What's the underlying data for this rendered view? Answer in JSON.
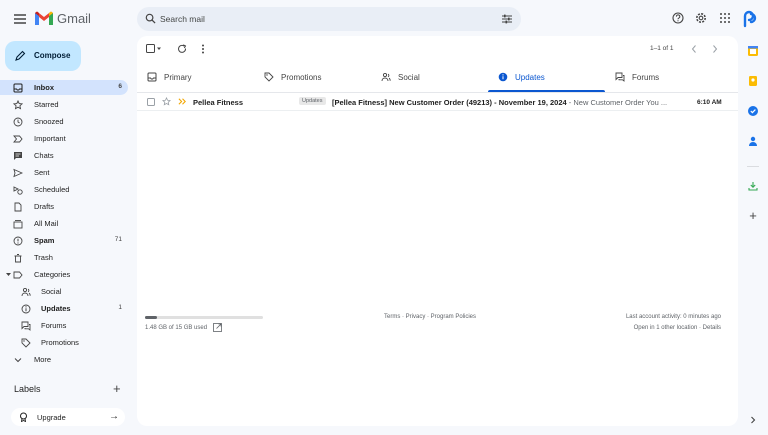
{
  "header": {
    "app_name": "Gmail",
    "search_placeholder": "Search mail"
  },
  "nav": {
    "compose_label": "Compose",
    "items": [
      {
        "label": "Inbox",
        "count": "6",
        "icon": "inbox-icon"
      },
      {
        "label": "Starred",
        "count": "",
        "icon": "star-icon"
      },
      {
        "label": "Snoozed",
        "count": "",
        "icon": "clock-icon"
      },
      {
        "label": "Important",
        "count": "",
        "icon": "important-icon"
      },
      {
        "label": "Chats",
        "count": "",
        "icon": "chat-icon"
      },
      {
        "label": "Sent",
        "count": "",
        "icon": "send-icon"
      },
      {
        "label": "Scheduled",
        "count": "",
        "icon": "scheduled-icon"
      },
      {
        "label": "Drafts",
        "count": "",
        "icon": "draft-icon"
      },
      {
        "label": "All Mail",
        "count": "",
        "icon": "all-mail-icon"
      },
      {
        "label": "Spam",
        "count": "71",
        "icon": "spam-icon"
      },
      {
        "label": "Trash",
        "count": "",
        "icon": "trash-icon"
      },
      {
        "label": "Categories",
        "count": "",
        "icon": "label-icon"
      },
      {
        "label": "Social",
        "count": "",
        "icon": "social-icon"
      },
      {
        "label": "Updates",
        "count": "1",
        "icon": "info-icon"
      },
      {
        "label": "Forums",
        "count": "",
        "icon": "forum-icon"
      },
      {
        "label": "Promotions",
        "count": "",
        "icon": "tag-icon"
      },
      {
        "label": "More",
        "count": "",
        "icon": "chevron-down-icon"
      }
    ],
    "labels_heading": "Labels",
    "upgrade_label": "Upgrade"
  },
  "toolbar": {
    "pager_text": "1–1 of 1"
  },
  "tabs": [
    {
      "label": "Primary",
      "active": false
    },
    {
      "label": "Promotions",
      "active": false
    },
    {
      "label": "Social",
      "active": false
    },
    {
      "label": "Updates",
      "active": true
    },
    {
      "label": "Forums",
      "active": false
    }
  ],
  "emails": [
    {
      "sender": "Pellea Fitness",
      "badge": "Updates",
      "subject": "[Pellea Fitness] New Customer Order (49213) - November 19, 2024",
      "snippet": " - New Customer Order You ...",
      "time": "6:10 AM"
    }
  ],
  "footer": {
    "storage_text": "1.48 GB of 15 GB used",
    "storage_fraction": 0.099,
    "links": "Terms · Privacy · Program Policies",
    "activity": "Last account activity: 0 minutes ago",
    "other_location": "Open in 1 other location · Details"
  },
  "colors": {
    "accent": "#0b57d0",
    "compose_bg": "#c2e7ff",
    "active_nav_bg": "#d3e3fd",
    "page_bg": "#f6f8fc"
  }
}
